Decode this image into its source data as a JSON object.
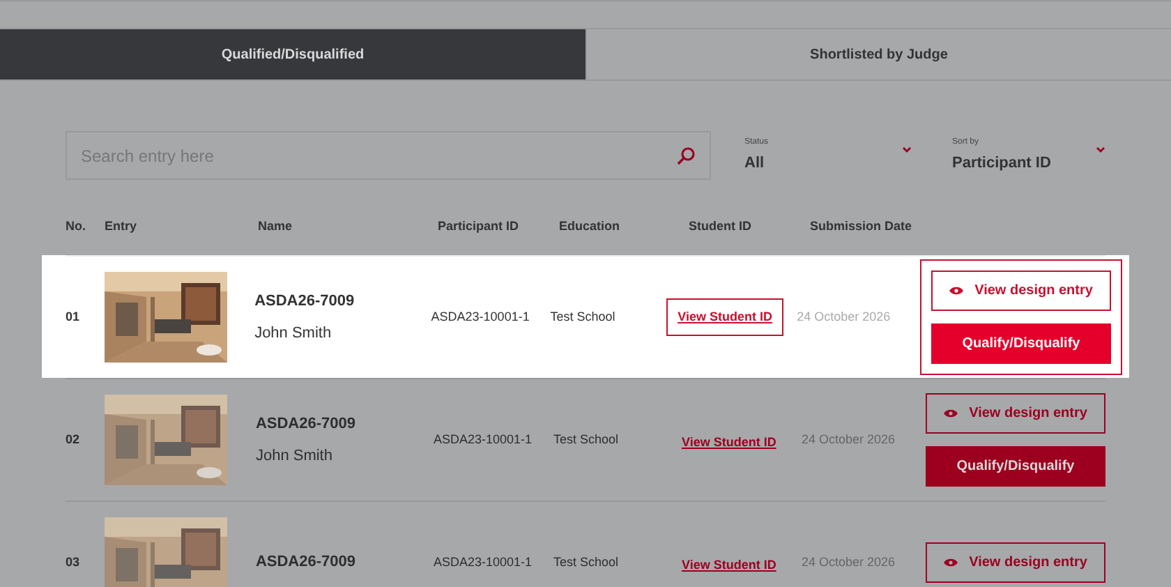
{
  "tabs": [
    {
      "label": "Qualified/Disqualified",
      "selected": true
    },
    {
      "label": "Shortlisted by Judge",
      "selected": false
    }
  ],
  "search": {
    "placeholder": "Search entry here"
  },
  "filters": [
    {
      "label": "Status",
      "value": "All"
    },
    {
      "label": "Sort by",
      "value": "Participant ID"
    }
  ],
  "table": {
    "columns": [
      "No.",
      "Entry",
      "Name",
      "Participant ID",
      "Education",
      "Student ID",
      "Submission Date"
    ],
    "rows": [
      {
        "no": "01",
        "highlighted": true,
        "code": "ASDA26-7009",
        "name": "John Smith",
        "participant_id": "ASDA23-10001-1",
        "education": "Test School",
        "student_id": "View Student ID",
        "date": "24 October 2026",
        "view_button": "View design entry",
        "qualify_button": "Qualify/Disqualify"
      },
      {
        "no": "02",
        "highlighted": false,
        "code": "ASDA26-7009",
        "name": "John Smith",
        "participant_id": "ASDA23-10001-1",
        "education": "Test School",
        "student_id": "View Student ID",
        "date": "24 October 2026",
        "view_button": "View design entry",
        "qualify_button": "Qualify/Disqualify"
      },
      {
        "no": "03",
        "highlighted": false,
        "code": "ASDA26-7009",
        "participant_id": "ASDA23-10001-1",
        "education": "Test School",
        "student_id": "View Student ID",
        "date": "24 October 2026",
        "view_button": "View design entry"
      }
    ]
  }
}
